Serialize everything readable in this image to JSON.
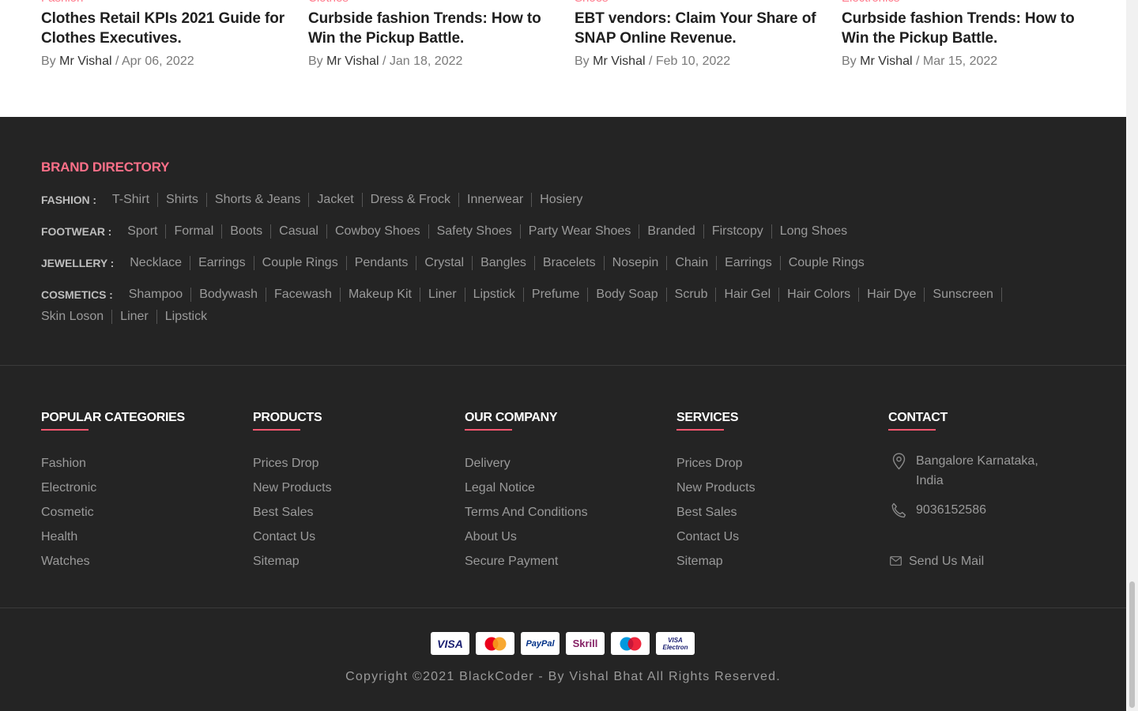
{
  "blog": [
    {
      "category": "Fashion",
      "title": "Clothes Retail KPIs 2021 Guide for Clothes Executives.",
      "by": "By",
      "author": "Mr Vishal",
      "sep": "/",
      "date": "Apr 06, 2022"
    },
    {
      "category": "Clothes",
      "title": "Curbside fashion Trends: How to Win the Pickup Battle.",
      "by": "By",
      "author": "Mr Vishal",
      "sep": "/",
      "date": "Jan 18, 2022"
    },
    {
      "category": "Shoes",
      "title": "EBT vendors: Claim Your Share of SNAP Online Revenue.",
      "by": "By",
      "author": "Mr Vishal",
      "sep": "/",
      "date": "Feb 10, 2022"
    },
    {
      "category": "Electronics",
      "title": "Curbside fashion Trends: How to Win the Pickup Battle.",
      "by": "By",
      "author": "Mr Vishal",
      "sep": "/",
      "date": "Mar 15, 2022"
    }
  ],
  "brand_directory": {
    "heading": "BRAND DIRECTORY",
    "rows": [
      {
        "label": "FASHION :",
        "items": [
          "T-Shirt",
          "Shirts",
          "Shorts & Jeans",
          "Jacket",
          "Dress & Frock",
          "Innerwear",
          "Hosiery"
        ]
      },
      {
        "label": "FOOTWEAR :",
        "items": [
          "Sport",
          "Formal",
          "Boots",
          "Casual",
          "Cowboy Shoes",
          "Safety Shoes",
          "Party Wear Shoes",
          "Branded",
          "Firstcopy",
          "Long Shoes"
        ]
      },
      {
        "label": "JEWELLERY :",
        "items": [
          "Necklace",
          "Earrings",
          "Couple Rings",
          "Pendants",
          "Crystal",
          "Bangles",
          "Bracelets",
          "Nosepin",
          "Chain",
          "Earrings",
          "Couple Rings"
        ]
      },
      {
        "label": "COSMETICS :",
        "items": [
          "Shampoo",
          "Bodywash",
          "Facewash",
          "Makeup Kit",
          "Liner",
          "Lipstick",
          "Prefume",
          "Body Soap",
          "Scrub",
          "Hair Gel",
          "Hair Colors",
          "Hair Dye",
          "Sunscreen",
          "Skin Loson",
          "Liner",
          "Lipstick"
        ]
      }
    ]
  },
  "columns": [
    {
      "title": "POPULAR CATEGORIES",
      "links": [
        "Fashion",
        "Electronic",
        "Cosmetic",
        "Health",
        "Watches"
      ]
    },
    {
      "title": "PRODUCTS",
      "links": [
        "Prices Drop",
        "New Products",
        "Best Sales",
        "Contact Us",
        "Sitemap"
      ]
    },
    {
      "title": "OUR COMPANY",
      "links": [
        "Delivery",
        "Legal Notice",
        "Terms And Conditions",
        "About Us",
        "Secure Payment"
      ]
    },
    {
      "title": "SERVICES",
      "links": [
        "Prices Drop",
        "New Products",
        "Best Sales",
        "Contact Us",
        "Sitemap"
      ]
    }
  ],
  "contact": {
    "title": "CONTACT",
    "address_line1": "Bangalore Karnataka,",
    "address_line2": "India",
    "phone": "9036152586",
    "mail": "Send Us Mail"
  },
  "payments": [
    {
      "icon": "visa-card-icon",
      "label": "VISA",
      "color": "#1a1f71"
    },
    {
      "icon": "mastercard-icon",
      "label": "",
      "color": "#eb001b"
    },
    {
      "icon": "paypal-icon",
      "label": "PayPal",
      "color": "#003087"
    },
    {
      "icon": "skrill-icon",
      "label": "Skrill",
      "color": "#862165"
    },
    {
      "icon": "maestro-icon",
      "label": "",
      "color": "#0099df"
    },
    {
      "icon": "visa-electron-icon",
      "label": "VISA Electron",
      "color": "#1a1f71"
    }
  ],
  "copyright": "Copyright ©2021 BlackCoder - By Vishal Bhat All Rights Reserved.",
  "colors": {
    "accent": "#ff5870",
    "footer_bg": "#242424"
  }
}
